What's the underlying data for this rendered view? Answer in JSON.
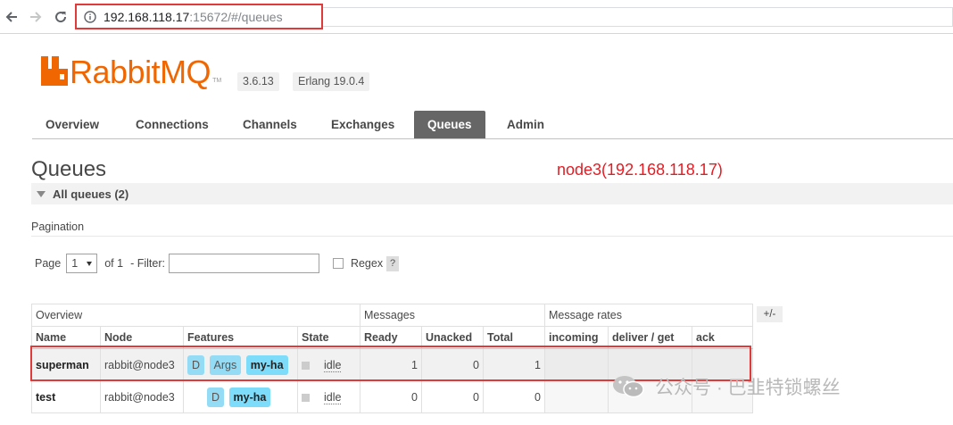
{
  "browser": {
    "url_host": "192.168.118.17",
    "url_rest": ":15672/#/queues"
  },
  "header": {
    "logo_text": "RabbitMQ",
    "logo_tm": "TM",
    "rabbitmq_version": "3.6.13",
    "erlang_version": "Erlang 19.0.4"
  },
  "tabs": [
    {
      "label": "Overview"
    },
    {
      "label": "Connections"
    },
    {
      "label": "Channels"
    },
    {
      "label": "Exchanges"
    },
    {
      "label": "Queues"
    },
    {
      "label": "Admin"
    }
  ],
  "page": {
    "title": "Queues",
    "annotation": "node3(192.168.118.17)",
    "section_title": "All queues (2)"
  },
  "pagination": {
    "label": "Pagination",
    "page_label": "Page",
    "page_value": "1",
    "of_label": "of 1",
    "filter_label": "- Filter:",
    "filter_value": "",
    "regex_label": "Regex",
    "help": "?"
  },
  "table": {
    "group_headers": [
      "Overview",
      "Messages",
      "Message rates"
    ],
    "columns": [
      "Name",
      "Node",
      "Features",
      "State",
      "Ready",
      "Unacked",
      "Total",
      "incoming",
      "deliver / get",
      "ack"
    ],
    "plus_minus": "+/-",
    "rows": [
      {
        "name": "superman",
        "node": "rabbit@node3",
        "features": [
          "D",
          "Args",
          "my-ha"
        ],
        "state": "idle",
        "ready": "1",
        "unacked": "0",
        "total": "1"
      },
      {
        "name": "test",
        "node": "rabbit@node3",
        "features": [
          "D",
          "my-ha"
        ],
        "state": "idle",
        "ready": "0",
        "unacked": "0",
        "total": "0"
      }
    ]
  },
  "watermark": {
    "text": "公众号 · 巴韭特锁螺丝"
  },
  "colors": {
    "brand_orange": "#f06600",
    "annotation_red": "#e51c23",
    "active_tab": "#666666",
    "feature_badge": "#94dbf5"
  }
}
